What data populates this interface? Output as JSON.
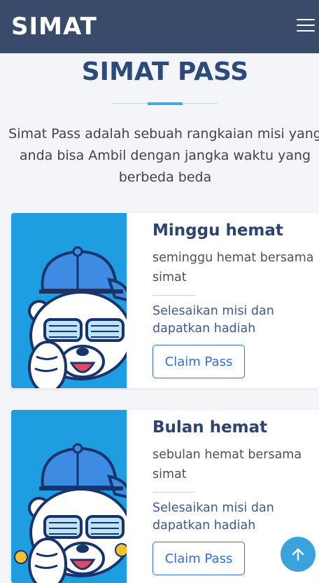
{
  "header": {
    "brand": "SIMAT",
    "menu_icon": "hamburger-menu-icon"
  },
  "section": {
    "title": "SIMAT PASS",
    "intro": "Simat Pass adalah sebuah rangkaian misi yang anda bisa Ambil dengan jangka waktu yang berbeda beda"
  },
  "passes": [
    {
      "title": "Minggu hemat",
      "description": "seminggu hemat bersama simat",
      "cta_text": "Selesaikan misi dan dapatkan hadiah",
      "button_label": "Claim Pass",
      "image": "polar-bear-cap-illustration"
    },
    {
      "title": "Bulan hemat",
      "description": "sebulan hemat bersama simat",
      "cta_text": "Selesaikan misi dan dapatkan hadiah",
      "button_label": "Claim Pass",
      "image": "polar-bear-cap-illustration"
    }
  ],
  "scroll_top_icon": "arrow-up-icon",
  "colors": {
    "navbar": "#3a4a6b",
    "title": "#2d4a7a",
    "accent": "#4aa8d8",
    "button": "#2f6fd6",
    "image_bg": "#1e9de0"
  }
}
